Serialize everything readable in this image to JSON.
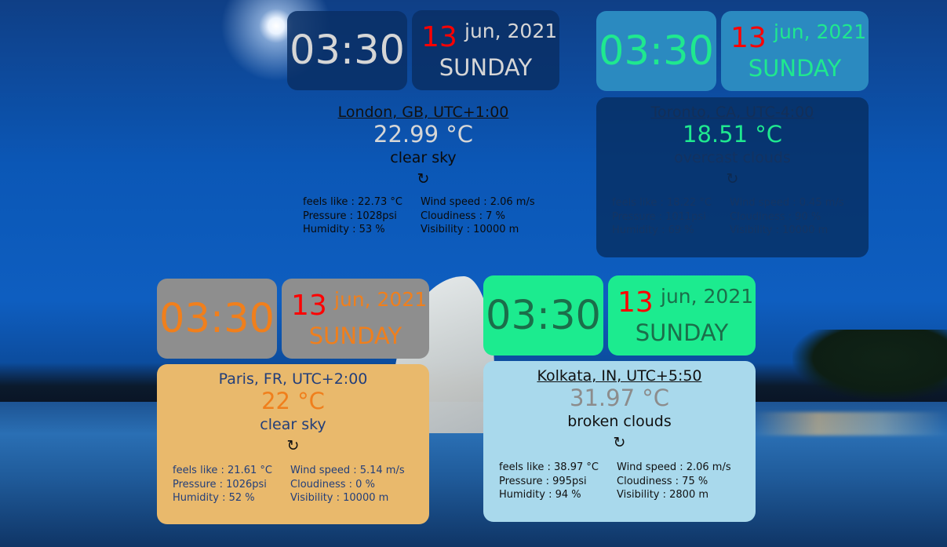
{
  "cities": {
    "london": {
      "time": "03:30",
      "day_num": "13",
      "month_year": "jun, 2021",
      "weekday": "SUNDAY",
      "location": "London, GB, UTC+1:00",
      "temperature": "22.99 °C",
      "description": "clear sky",
      "refresh_icon": "refresh-icon",
      "feels_like": "feels like : 22.73 °C",
      "pressure": "Pressure : 1028psi",
      "humidity": "Humidity : 53 %",
      "wind_speed": "Wind speed : 2.06 m/s",
      "cloudiness": "Cloudiness : 7 %",
      "visibility": "Visibility : 10000 m"
    },
    "toronto": {
      "time": "03:30",
      "day_num": "13",
      "month_year": "jun, 2021",
      "weekday": "SUNDAY",
      "location": "Toronto, CA, UTC-4:00",
      "temperature": "18.51 °C",
      "description": "overcast clouds",
      "refresh_icon": "refresh-icon",
      "feels_like": "feels like : 18.22 °C",
      "pressure": "Pressure : 1011psi",
      "humidity": "Humidity : 69 %",
      "wind_speed": "Wind speed : 0.45 m/s",
      "cloudiness": "Cloudiness : 90 %",
      "visibility": "Visibility : 10000 m"
    },
    "paris": {
      "time": "03:30",
      "day_num": "13",
      "month_year": "jun, 2021",
      "weekday": "SUNDAY",
      "location": "Paris, FR, UTC+2:00",
      "temperature": "22 °C",
      "description": "clear sky",
      "refresh_icon": "refresh-icon",
      "feels_like": "feels like : 21.61 °C",
      "pressure": "Pressure : 1026psi",
      "humidity": "Humidity : 52 %",
      "wind_speed": "Wind speed : 5.14 m/s",
      "cloudiness": "Cloudiness : 0 %",
      "visibility": "Visibility : 10000 m"
    },
    "kolkata": {
      "time": "03:30",
      "day_num": "13",
      "month_year": "jun, 2021",
      "weekday": "SUNDAY",
      "location": "Kolkata, IN, UTC+5:50",
      "temperature": "31.97 °C",
      "description": "broken clouds",
      "refresh_icon": "refresh-icon",
      "feels_like": "feels like : 38.97 °C",
      "pressure": "Pressure : 995psi",
      "humidity": "Humidity : 94 %",
      "wind_speed": "Wind speed : 2.06 m/s",
      "cloudiness": "Cloudiness : 75 %",
      "visibility": "Visibility : 2800 m"
    }
  },
  "colors": {
    "day_num": "#ff0000",
    "toronto_accent": "#1fe88f",
    "paris_accent": "#f07f1c",
    "kolkata_card": "#1ceb8f"
  }
}
